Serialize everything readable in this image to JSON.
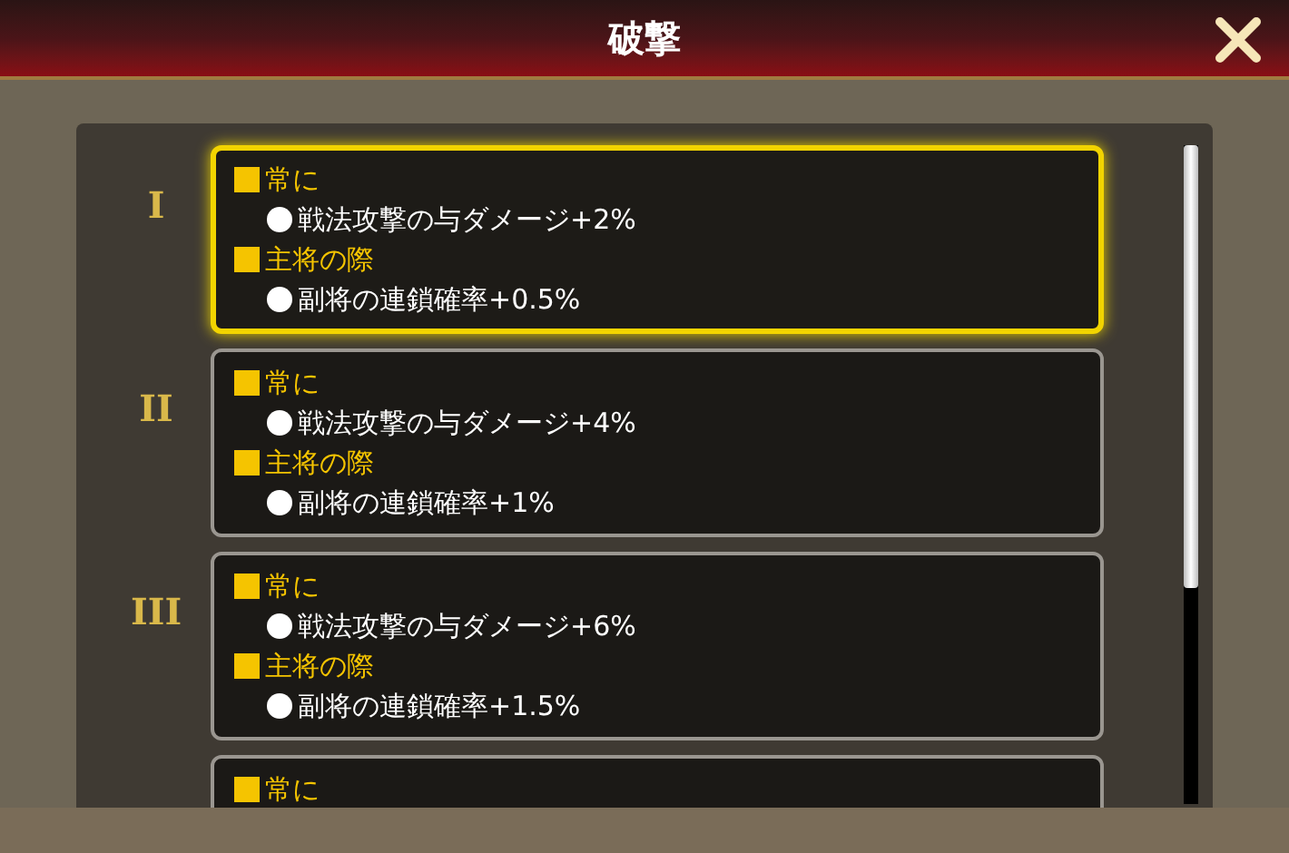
{
  "window": {
    "title": "破撃"
  },
  "tiers": [
    {
      "numeral": "I",
      "selected": true,
      "sections": [
        {
          "heading": "常に",
          "items": [
            "戦法攻撃の与ダメージ+2%"
          ]
        },
        {
          "heading": "主将の際",
          "items": [
            "副将の連鎖確率+0.5%"
          ]
        }
      ]
    },
    {
      "numeral": "II",
      "selected": false,
      "sections": [
        {
          "heading": "常に",
          "items": [
            "戦法攻撃の与ダメージ+4%"
          ]
        },
        {
          "heading": "主将の際",
          "items": [
            "副将の連鎖確率+1%"
          ]
        }
      ]
    },
    {
      "numeral": "III",
      "selected": false,
      "sections": [
        {
          "heading": "常に",
          "items": [
            "戦法攻撃の与ダメージ+6%"
          ]
        },
        {
          "heading": "主将の際",
          "items": [
            "副将の連鎖確率+1.5%"
          ]
        }
      ]
    },
    {
      "selected": false,
      "sections": [
        {
          "heading": "常に"
        }
      ]
    }
  ]
}
